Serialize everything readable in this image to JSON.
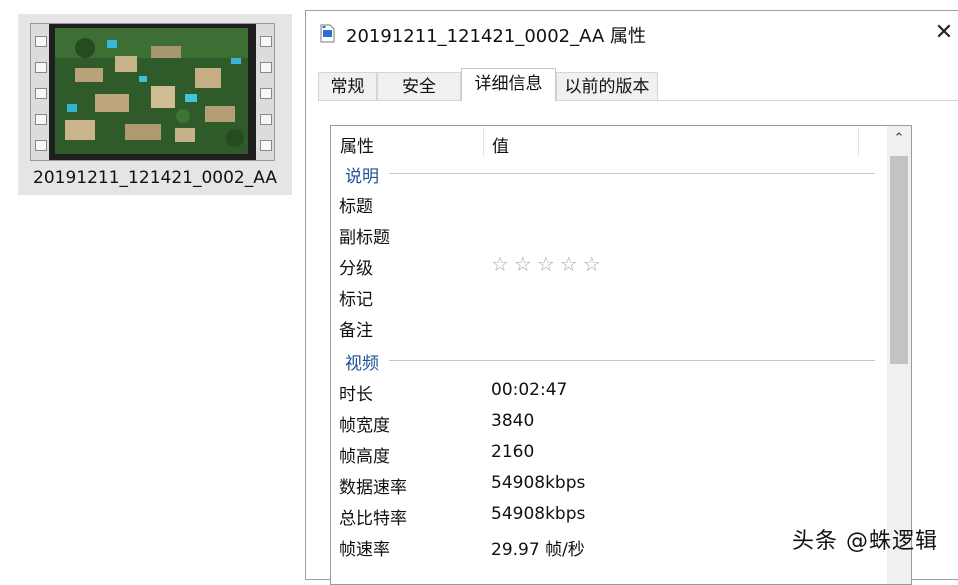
{
  "file_tile": {
    "name": "20191211_121421_0002_AA"
  },
  "dialog": {
    "title": "20191211_121421_0002_AA 属性",
    "tabs": [
      {
        "label": "常规"
      },
      {
        "label": "安全"
      },
      {
        "label": "详细信息",
        "active": true
      },
      {
        "label": "以前的版本"
      }
    ],
    "columns": {
      "property": "属性",
      "value": "值"
    },
    "groups": {
      "description": {
        "label": "说明",
        "rows": [
          {
            "key": "标题",
            "value": ""
          },
          {
            "key": "副标题",
            "value": ""
          },
          {
            "key": "分级",
            "value": ""
          },
          {
            "key": "标记",
            "value": ""
          },
          {
            "key": "备注",
            "value": ""
          }
        ],
        "rating_stars": "☆☆☆☆☆",
        "rating": 0
      },
      "video": {
        "label": "视频",
        "rows": [
          {
            "key": "时长",
            "value": "00:02:47"
          },
          {
            "key": "帧宽度",
            "value": "3840"
          },
          {
            "key": "帧高度",
            "value": "2160"
          },
          {
            "key": "数据速率",
            "value": "54908kbps"
          },
          {
            "key": "总比特率",
            "value": "54908kbps"
          },
          {
            "key": "帧速率",
            "value": "29.97 帧/秒"
          }
        ]
      }
    }
  },
  "watermark": "头条 @蛛逻辑",
  "icons": {
    "file_icon": "video-file-icon",
    "close": "close-icon",
    "scroll_up": "chevron-up-icon"
  },
  "colors": {
    "group_header": "#1f4e9a",
    "tile_background": "#e5e5e5"
  }
}
